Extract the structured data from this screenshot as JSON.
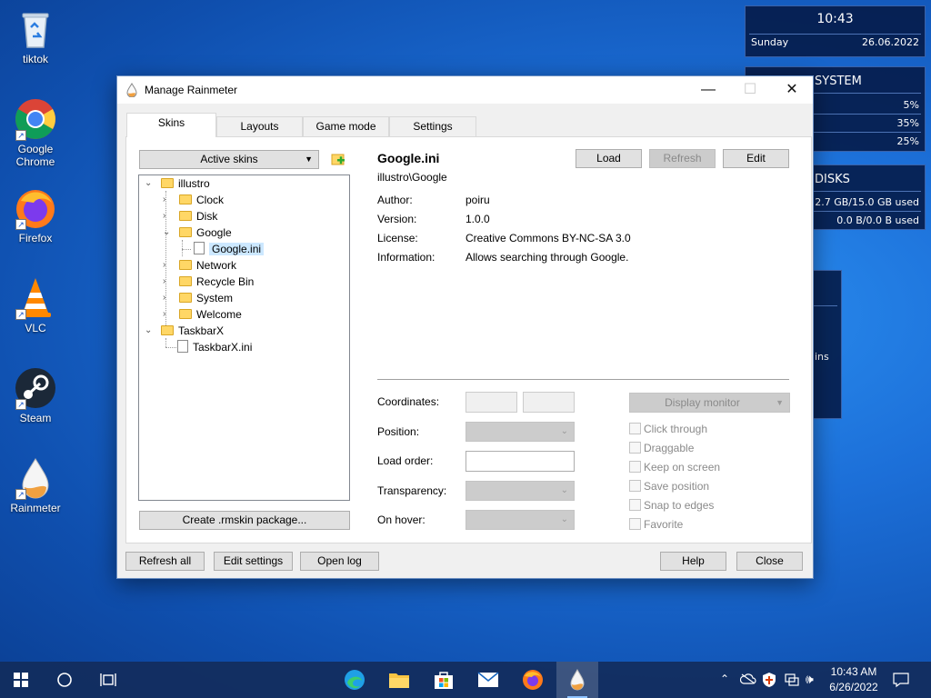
{
  "desktop": {
    "icons": [
      {
        "label": "tiktok"
      },
      {
        "label": "Google Chrome"
      },
      {
        "label": "Firefox"
      },
      {
        "label": "VLC"
      },
      {
        "label": "Steam"
      },
      {
        "label": "Rainmeter"
      }
    ]
  },
  "widgets": {
    "clock": {
      "time": "10:43",
      "day": "Sunday",
      "date": "26.06.2022"
    },
    "system": {
      "title": "SYSTEM",
      "values": [
        "5%",
        "35%",
        "25%"
      ]
    },
    "disks": {
      "title": "DISKS",
      "values": [
        "2.7 GB/15.0 GB used",
        "0.0 B/0.0 B used"
      ]
    },
    "partial": {
      "text": "ins"
    }
  },
  "window": {
    "title": "Manage Rainmeter",
    "controls": {
      "minimize": "—",
      "maximize": "☐",
      "close": "✕"
    },
    "tabs": [
      "Skins",
      "Layouts",
      "Game mode",
      "Settings"
    ],
    "skins": {
      "dropdown": "Active skins",
      "tree": [
        {
          "label": "illustro"
        },
        {
          "label": "Clock"
        },
        {
          "label": "Disk"
        },
        {
          "label": "Google"
        },
        {
          "label": "Google.ini"
        },
        {
          "label": "Network"
        },
        {
          "label": "Recycle Bin"
        },
        {
          "label": "System"
        },
        {
          "label": "Welcome"
        },
        {
          "label": "TaskbarX"
        },
        {
          "label": "TaskbarX.ini"
        }
      ],
      "create_package": "Create .rmskin package..."
    },
    "details": {
      "name": "Google.ini",
      "path": "illustro\\Google",
      "buttons": {
        "load": "Load",
        "refresh": "Refresh",
        "edit": "Edit"
      },
      "fields": [
        {
          "label": "Author:",
          "value": "poiru"
        },
        {
          "label": "Version:",
          "value": "1.0.0"
        },
        {
          "label": "License:",
          "value": "Creative Commons BY-NC-SA 3.0"
        },
        {
          "label": "Information:",
          "value": "Allows searching through Google."
        }
      ],
      "settings": {
        "coordinates": "Coordinates:",
        "position": "Position:",
        "load_order": "Load order:",
        "transparency": "Transparency:",
        "on_hover": "On hover:",
        "display_monitor": "Display monitor"
      },
      "checkboxes": [
        "Click through",
        "Draggable",
        "Keep on screen",
        "Save position",
        "Snap to edges",
        "Favorite"
      ]
    },
    "footer": {
      "refresh_all": "Refresh all",
      "edit_settings": "Edit settings",
      "open_log": "Open log",
      "help": "Help",
      "close": "Close"
    }
  },
  "taskbar": {
    "time": "10:43 AM",
    "date": "6/26/2022",
    "apps": [
      "Edge",
      "File Explorer",
      "Microsoft Store",
      "Mail",
      "Firefox",
      "Rainmeter"
    ]
  }
}
